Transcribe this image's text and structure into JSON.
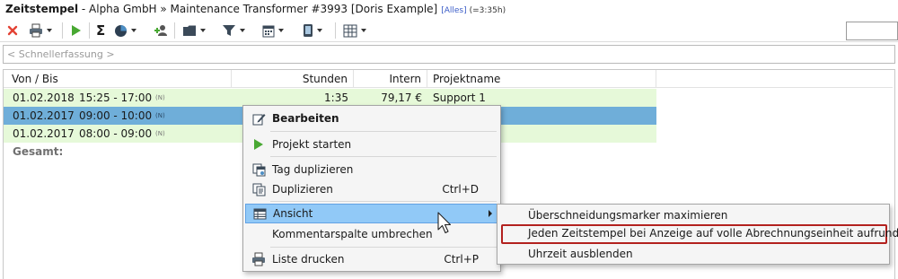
{
  "window": {
    "app": "Zeitstempel",
    "breadcrumb": " - Alpha GmbH » Maintenance Transformer #3993 [Doris Example]",
    "filter_tag": "[Alles]",
    "duration": "(=3:35h)"
  },
  "toolbar": {
    "icons": [
      "close-icon",
      "print-icon",
      "play-icon",
      "sum-icon",
      "pie-chart-icon",
      "add-user-icon",
      "folder-icon",
      "filter-icon",
      "calendar-icon",
      "device-icon",
      "export-icon"
    ],
    "colors": {
      "close": "#e34234",
      "play": "#48a832"
    }
  },
  "quick_entry": {
    "placeholder": "< Schnellerfassung >"
  },
  "table": {
    "columns": [
      "Von / Bis",
      "Stunden",
      "Intern",
      "Projektname"
    ],
    "rows": [
      {
        "date": "01.02.2018",
        "time": "15:25 - 17:00",
        "flag": "(N)",
        "hours": "1:35",
        "intern": "79,17 €",
        "project": "Support 1",
        "style": "green"
      },
      {
        "date": "01.02.2017",
        "time": "09:00 - 10:00",
        "flag": "(N)",
        "hours": "",
        "intern": "",
        "project": "",
        "style": "selected"
      },
      {
        "date": "01.02.2017",
        "time": "08:00 - 09:00",
        "flag": "(N)",
        "hours": "",
        "intern": "",
        "project": "",
        "style": "green"
      }
    ],
    "total_label": "Gesamt:",
    "colors": {
      "row_green": "#e6f9d9",
      "row_selected": "#6faed9"
    }
  },
  "context_menu": {
    "items": [
      {
        "label": "Bearbeiten",
        "icon": "edit-icon",
        "shortcut": ""
      },
      {
        "label": "Projekt starten",
        "icon": "play-icon",
        "shortcut": ""
      },
      {
        "label": "Tag duplizieren",
        "icon": "duplicate-day-icon",
        "shortcut": ""
      },
      {
        "label": "Duplizieren",
        "icon": "duplicate-icon",
        "shortcut": "Ctrl+D"
      },
      {
        "label": "Ansicht",
        "icon": "view-icon",
        "shortcut": ""
      },
      {
        "label": "Kommentarspalte umbrechen",
        "icon": "",
        "shortcut": ""
      },
      {
        "label": "Liste drucken",
        "icon": "print-icon",
        "shortcut": "Ctrl+P"
      }
    ]
  },
  "submenu": {
    "items": [
      "Überschneidungsmarker maximieren",
      "Jeden Zeitstempel bei Anzeige auf volle Abrechnungseinheit aufrunden",
      "Uhrzeit ausblenden"
    ],
    "highlight_color": "#b3211e"
  }
}
